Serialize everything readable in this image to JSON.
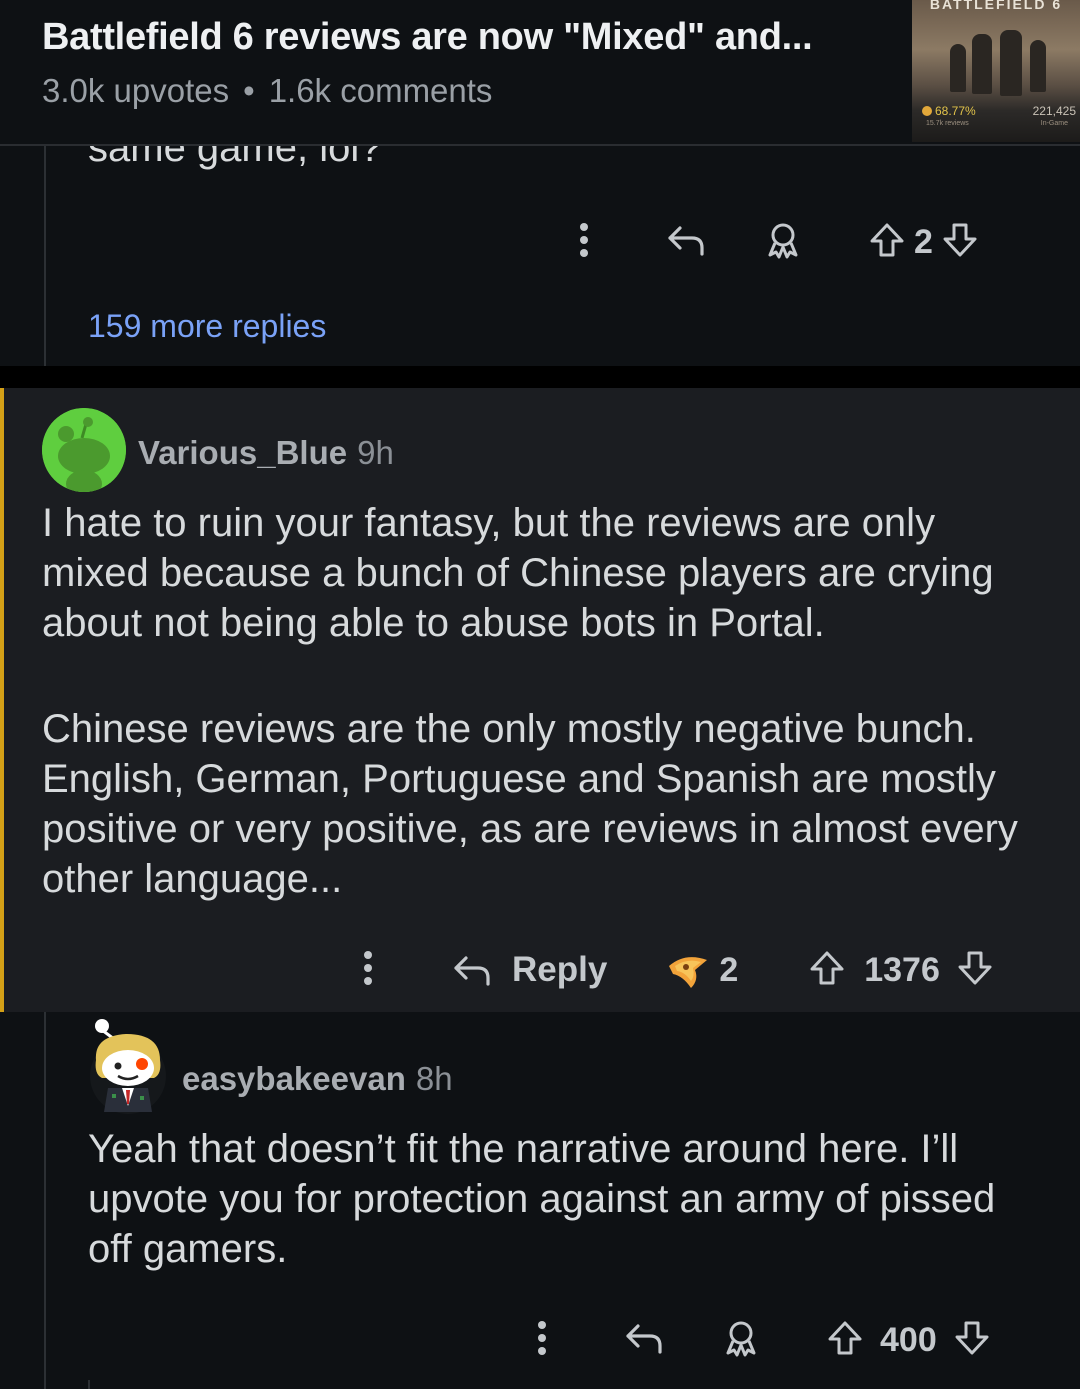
{
  "post": {
    "title": "Battlefield 6 reviews are now \"Mixed\" and...",
    "upvotes": "3.0k upvotes",
    "separator": "•",
    "comments": "1.6k comments",
    "thumbnail": {
      "game_title": "BATTLEFIELD 6",
      "score": "68.77%",
      "score_sub": "15.7k reviews",
      "player_count": "221,425",
      "player_count_sub": "In-Game"
    }
  },
  "comment_previous": {
    "text_fragment": "same game, lol?",
    "votes": "2",
    "more_replies": "159 more replies"
  },
  "comment_main": {
    "username": "Various_Blue",
    "time": "9h",
    "paragraphs": [
      "I hate to ruin your fantasy, but the reviews are only mixed because a bunch of Chinese players are crying about not being able to abuse bots in Portal.",
      "Chinese reviews are the only mostly negative bunch. English, German, Portuguese and Spanish are mostly positive or very positive, as are reviews in almost every other language..."
    ],
    "reply_label": "Reply",
    "award_count": "2",
    "votes": "1376",
    "highlight_color": "#d4a017"
  },
  "comment_reply": {
    "username": "easybakeevan",
    "time": "8h",
    "text": "Yeah that doesn’t fit the narrative around here. I’ll upvote you for protection against an army of pissed off gamers.",
    "votes": "400"
  },
  "icons": [
    "more-options-icon",
    "reply-icon",
    "award-icon",
    "upvote-icon",
    "downvote-icon",
    "gold-award-icon"
  ],
  "colors": {
    "background": "#0e1114",
    "link": "#7aa2f7",
    "avatar_green": "#5fce3f"
  }
}
